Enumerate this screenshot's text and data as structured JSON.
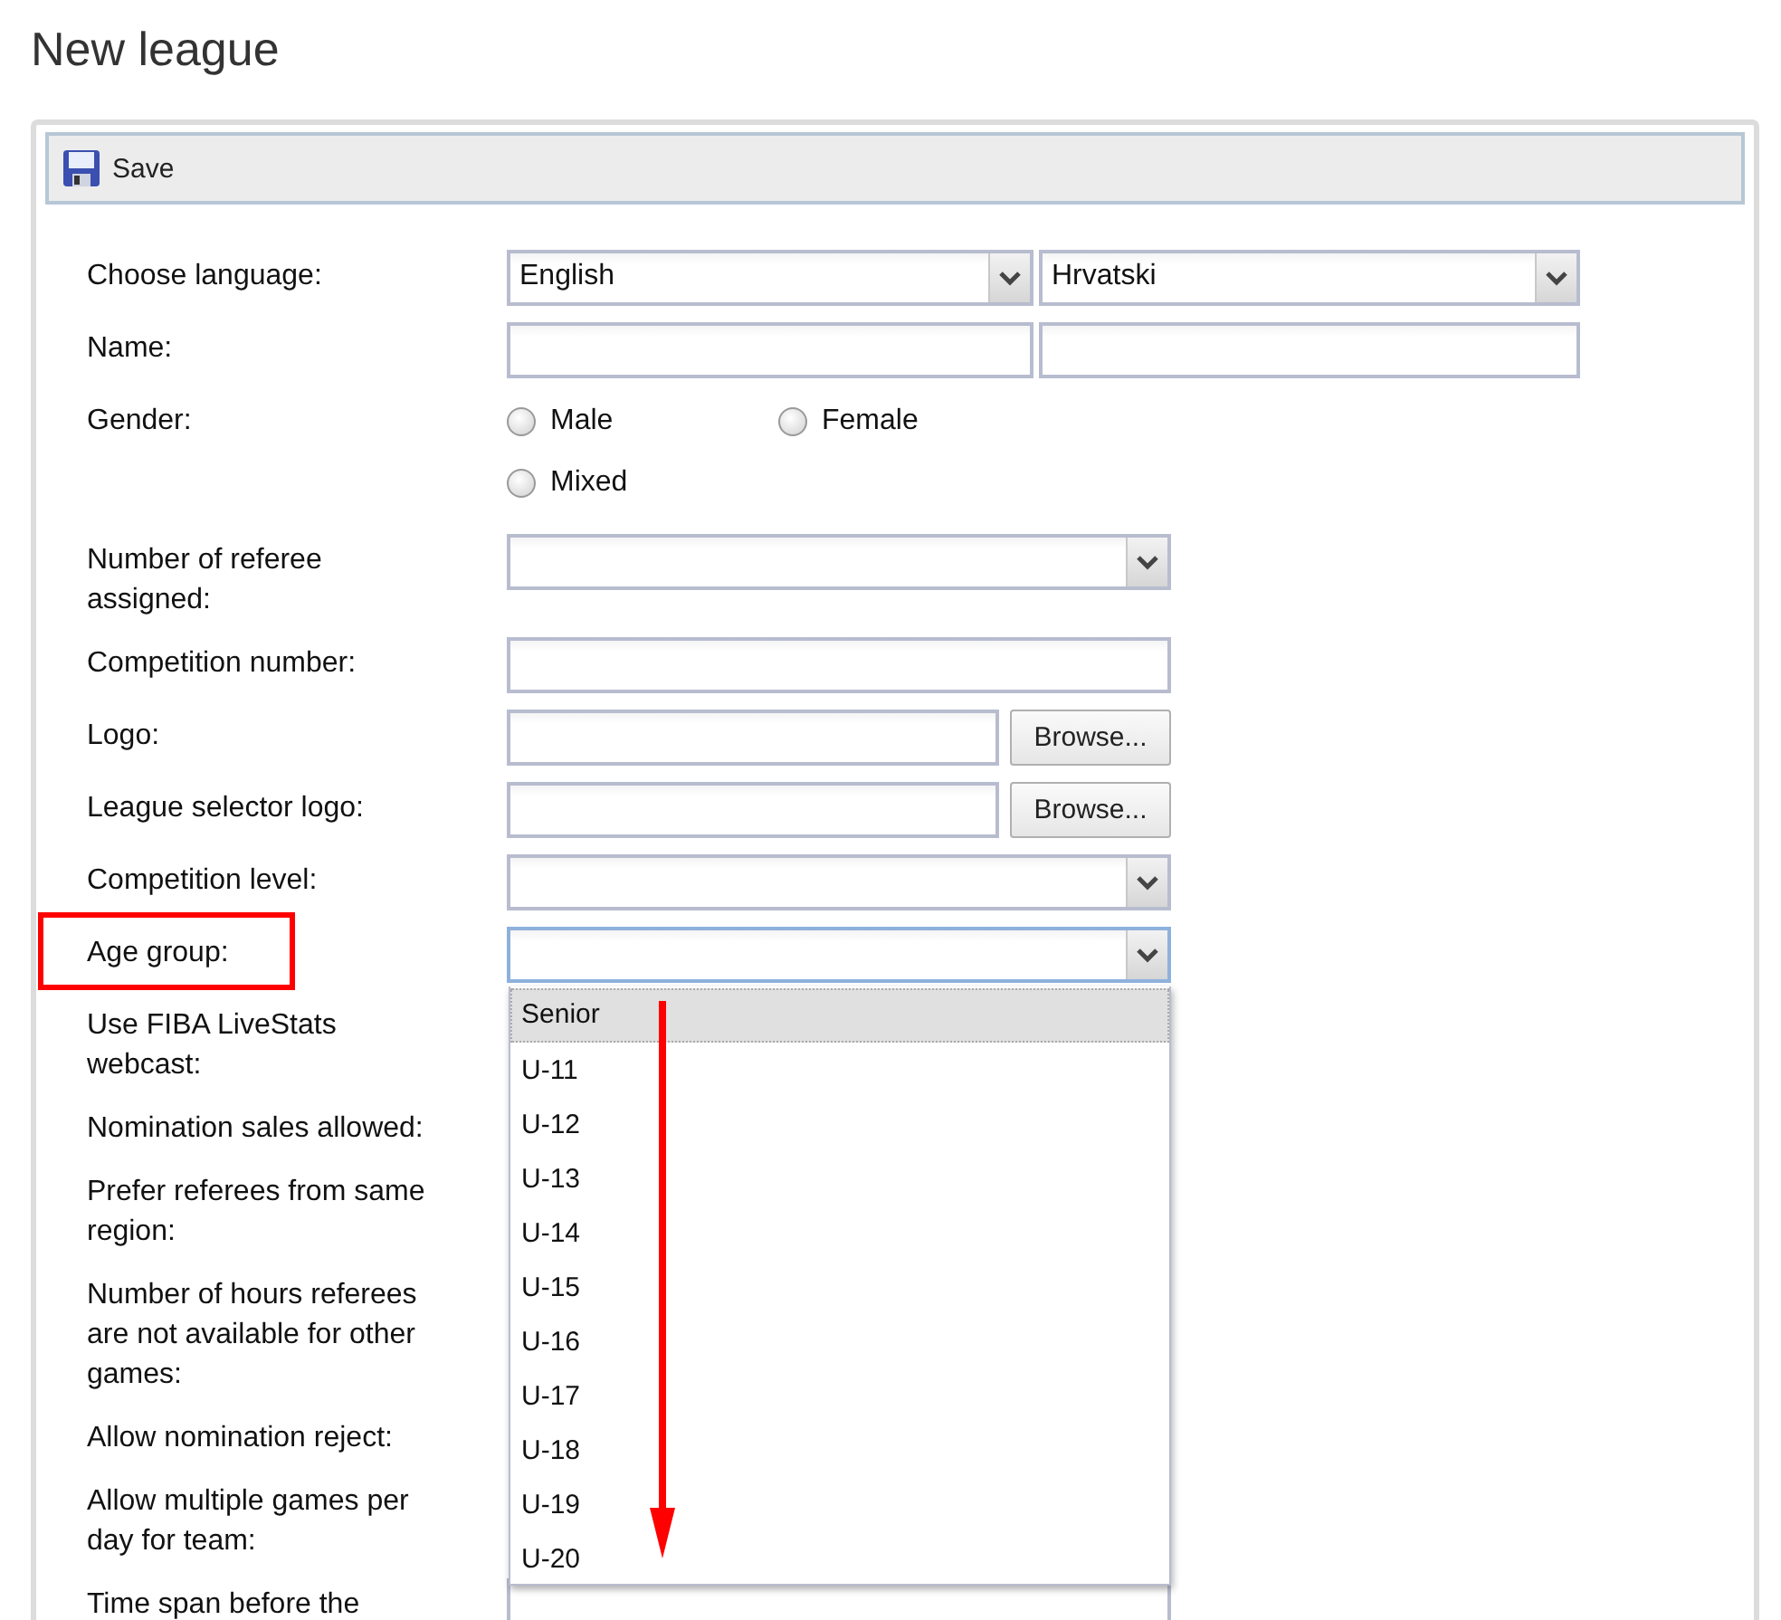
{
  "page_title": "New league",
  "toolbar": {
    "save_label": "Save"
  },
  "rows": [
    {
      "label": "Choose language:",
      "kind": "select-pair",
      "values": [
        "English",
        "Hrvatski"
      ]
    },
    {
      "label": "Name:",
      "kind": "input-pair"
    },
    {
      "label": "Gender:",
      "kind": "radios",
      "options": [
        {
          "label": "Male",
          "selected": false
        },
        {
          "label": "Female",
          "selected": false
        },
        {
          "label": "Mixed",
          "selected": false
        }
      ]
    },
    {
      "label": "Number of referee assigned:",
      "kind": "select",
      "focused": false
    },
    {
      "label": "Competition number:",
      "kind": "input"
    },
    {
      "label": "Logo:",
      "kind": "file",
      "button": "Browse..."
    },
    {
      "label": "League selector logo:",
      "kind": "file",
      "button": "Browse..."
    },
    {
      "label": "Competition level:",
      "kind": "select",
      "focused": false
    },
    {
      "label": "Age group:",
      "kind": "select",
      "focused": true
    },
    {
      "label": "Use FIBA LiveStats webcast:",
      "kind": "covered"
    },
    {
      "label": "Nomination sales allowed:",
      "kind": "covered"
    },
    {
      "label": "Prefer referees from same region:",
      "kind": "covered"
    },
    {
      "label": "Number of hours referees are not available for other games:",
      "kind": "covered"
    },
    {
      "label": "Allow nomination reject:",
      "kind": "covered"
    },
    {
      "label": "Allow multiple games per day for team:",
      "kind": "covered"
    },
    {
      "label": "Time span before the",
      "kind": "input"
    }
  ],
  "dropdown": {
    "options": [
      {
        "label": "Senior",
        "selected": true
      },
      {
        "label": "U-11",
        "selected": false
      },
      {
        "label": "U-12",
        "selected": false
      },
      {
        "label": "U-13",
        "selected": false
      },
      {
        "label": "U-14",
        "selected": false
      },
      {
        "label": "U-15",
        "selected": false
      },
      {
        "label": "U-16",
        "selected": false
      },
      {
        "label": "U-17",
        "selected": false
      },
      {
        "label": "U-18",
        "selected": false
      },
      {
        "label": "U-19",
        "selected": false
      },
      {
        "label": "U-20",
        "selected": false
      }
    ]
  }
}
